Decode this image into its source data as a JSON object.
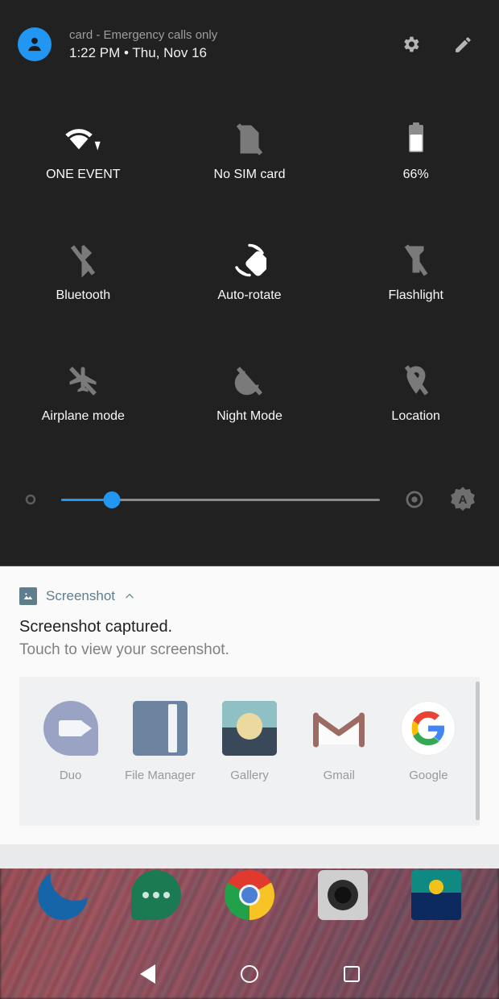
{
  "status_header": {
    "avatar_icon": "person-avatar-icon",
    "carrier_text": "card - Emergency calls only",
    "clock_line": "1:22 PM • Thu, Nov 16",
    "settings_icon": "gear-icon",
    "edit_icon": "pencil-icon"
  },
  "quick_settings": {
    "tiles": [
      {
        "label": "ONE EVENT",
        "icon": "wifi-icon",
        "state": "on"
      },
      {
        "label": "No SIM card",
        "icon": "sim-off-icon",
        "state": "off"
      },
      {
        "label": "66%",
        "icon": "battery-icon",
        "state": "on"
      },
      {
        "label": "Bluetooth",
        "icon": "bluetooth-off-icon",
        "state": "off"
      },
      {
        "label": "Auto-rotate",
        "icon": "auto-rotate-icon",
        "state": "on"
      },
      {
        "label": "Flashlight",
        "icon": "flashlight-off-icon",
        "state": "off"
      },
      {
        "label": "Airplane mode",
        "icon": "airplane-off-icon",
        "state": "off"
      },
      {
        "label": "Night Mode",
        "icon": "night-mode-icon",
        "state": "off"
      },
      {
        "label": "Location",
        "icon": "location-off-icon",
        "state": "off"
      }
    ],
    "brightness": {
      "low_icon": "brightness-low-icon",
      "high_icon": "brightness-high-icon",
      "auto_icon": "auto-brightness-icon",
      "auto_label": "A",
      "value_percent": 16,
      "fill_color": "#2196f3"
    }
  },
  "notification": {
    "app_icon": "image-icon",
    "app_name": "Screenshot",
    "collapse_icon": "chevron-up-icon",
    "title": "Screenshot captured.",
    "body": "Touch to view your screenshot.",
    "share_apps": [
      {
        "label": "Duo",
        "icon": "duo-icon"
      },
      {
        "label": "File Manager",
        "icon": "file-manager-icon"
      },
      {
        "label": "Gallery",
        "icon": "gallery-icon"
      },
      {
        "label": "Gmail",
        "icon": "gmail-icon"
      },
      {
        "label": "Google",
        "icon": "google-icon"
      }
    ]
  },
  "dock": {
    "items": [
      {
        "label": "Phone",
        "icon": "phone-icon"
      },
      {
        "label": "Messages",
        "icon": "messages-icon"
      },
      {
        "label": "Chrome",
        "icon": "chrome-icon"
      },
      {
        "label": "Camera",
        "icon": "camera-icon"
      },
      {
        "label": "Gallery",
        "icon": "gallery-icon"
      }
    ]
  },
  "navigation_bar": {
    "back": "back-icon",
    "home": "home-icon",
    "recents": "recents-icon"
  }
}
